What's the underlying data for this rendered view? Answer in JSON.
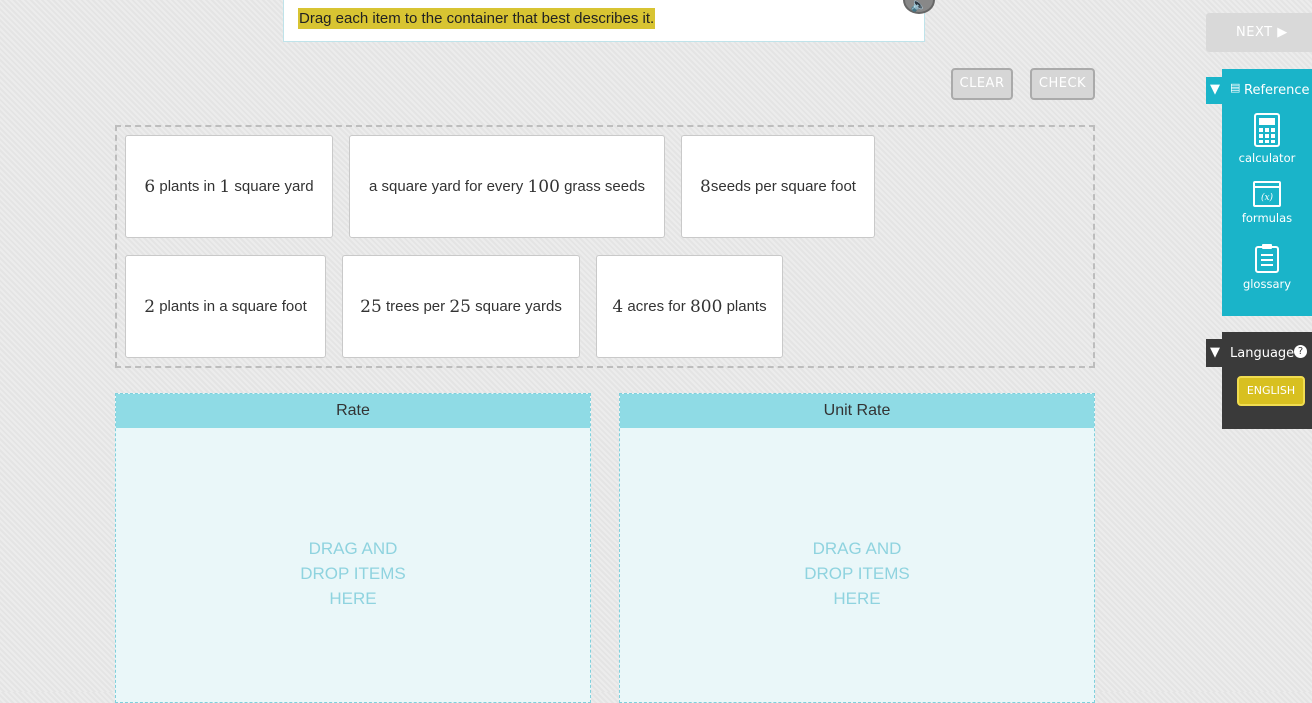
{
  "instruction": "Drag each item to the container that best describes it.",
  "toolbar": {
    "clear_label": "CLEAR",
    "check_label": "CHECK",
    "next_label": "NEXT"
  },
  "cards": [
    {
      "n1": "6",
      "t1": "plants in",
      "n2": "1",
      "t2": "square yard"
    },
    {
      "t0": "a square yard for every",
      "n1": "100",
      "t1": "grass seeds"
    },
    {
      "n1": "8",
      "t1": "seeds per square foot"
    },
    {
      "n1": "2",
      "t1": "plants in a square foot"
    },
    {
      "n1": "25",
      "t1": "trees per",
      "n2": "25",
      "t2": "square yards"
    },
    {
      "n1": "4",
      "t1": "acres for",
      "n2": "800",
      "t2": "plants"
    }
  ],
  "buckets": [
    {
      "title": "Rate",
      "hint": [
        "DRAG AND",
        "DROP ITEMS",
        "HERE"
      ]
    },
    {
      "title": "Unit Rate",
      "hint": [
        "DRAG AND",
        "DROP ITEMS",
        "HERE"
      ]
    }
  ],
  "sidebar": {
    "reference_label": "Reference",
    "tools": [
      {
        "label": "calculator"
      },
      {
        "label": "formulas"
      },
      {
        "label": "glossary"
      }
    ],
    "language_label": "Language",
    "language_value": "ENGLISH"
  },
  "colors": {
    "accent": "#1ab4c9",
    "highlight": "#d8c432",
    "bucket_header": "#8fdbe5"
  }
}
